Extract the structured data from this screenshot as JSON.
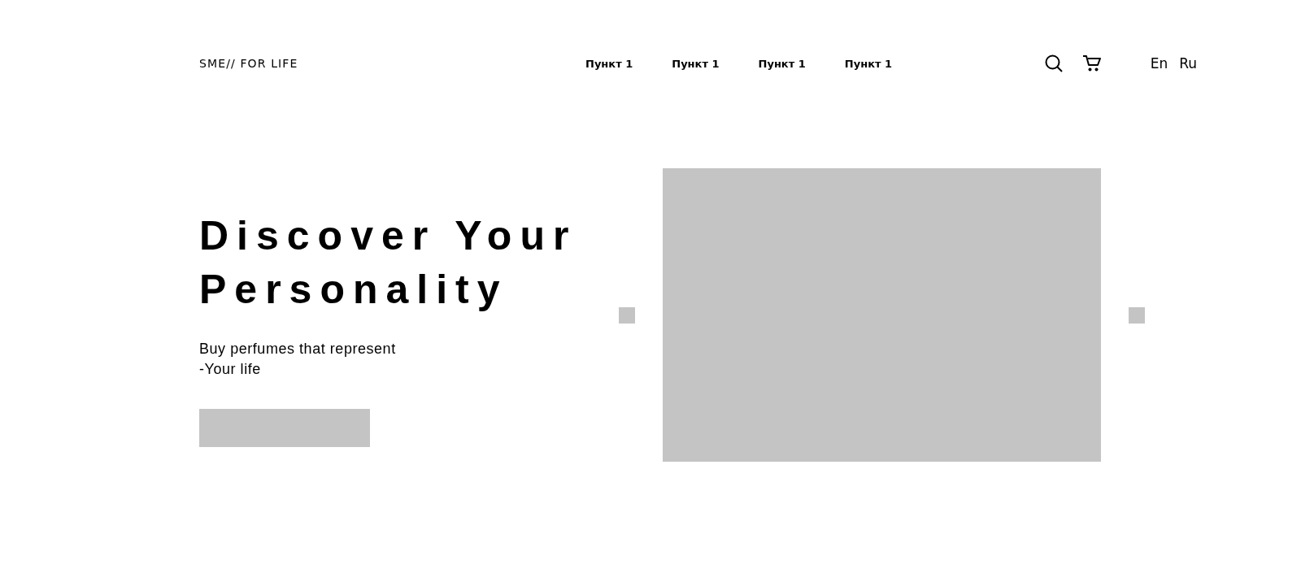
{
  "logo": "SME// FOR LIFE",
  "nav": [
    "Пункт 1",
    "Пункт 1",
    "Пункт 1",
    "Пункт 1"
  ],
  "languages": [
    "En",
    "Ru"
  ],
  "hero": {
    "heading": [
      "Discover Your",
      "Personality"
    ],
    "subtitle": [
      "Buy perfumes that represent",
      "-Your life"
    ]
  }
}
